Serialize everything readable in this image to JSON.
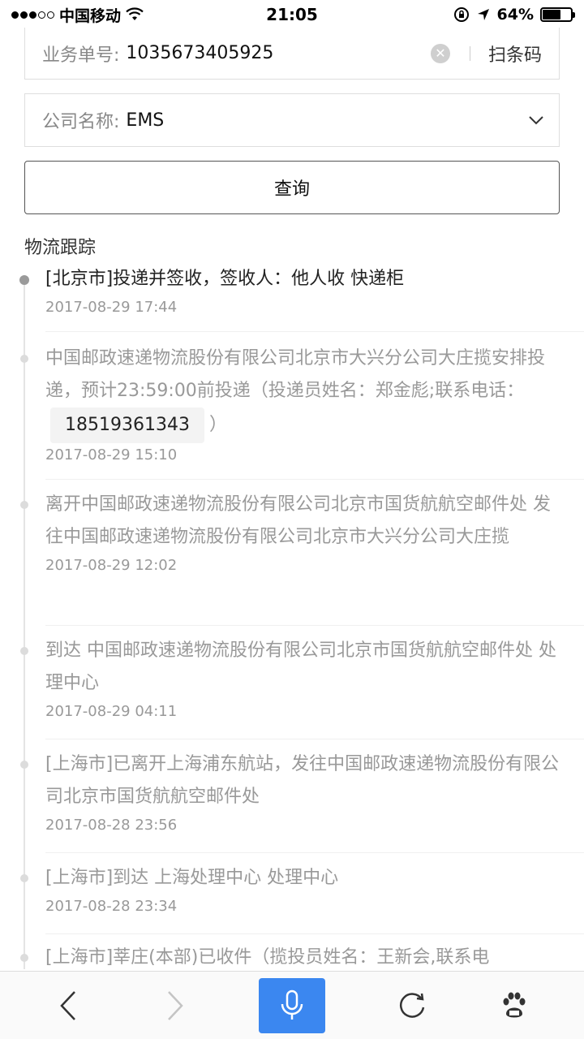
{
  "status_bar": {
    "carrier": "中国移动",
    "time": "21:05",
    "battery_percent": "64%",
    "battery_level": 0.64
  },
  "order_field": {
    "label": "业务单号:",
    "value": "1035673405925",
    "scan_label": "扫条码"
  },
  "company_field": {
    "label": "公司名称:",
    "value": "EMS"
  },
  "query_button": "查询",
  "section_title": "物流跟踪",
  "tracking": [
    {
      "text": "[北京市]投递并签收，签收人：他人收 快递柜",
      "time": "2017-08-29 17:44"
    },
    {
      "text_before": "中国邮政速递物流股份有限公司北京市大兴分公司大庄揽安排投递，预计23:59:00前投递（投递员姓名：郑金彪;联系电话：",
      "phone": "18519361343",
      "text_after": "）",
      "time": "2017-08-29 15:10"
    },
    {
      "text": "离开中国邮政速递物流股份有限公司北京市国货航航空邮件处 发往中国邮政速递物流股份有限公司北京市大兴分公司大庄揽",
      "time": "2017-08-29 12:02"
    },
    {
      "text": "到达 中国邮政速递物流股份有限公司北京市国货航航空邮件处 处理中心",
      "time": "2017-08-29 04:11"
    },
    {
      "text": "[上海市]已离开上海浦东航站，发往中国邮政速递物流股份有限公司北京市国货航航空邮件处",
      "time": "2017-08-28 23:56"
    },
    {
      "text": "[上海市]到达 上海处理中心 处理中心",
      "time": "2017-08-28 23:34"
    },
    {
      "text": "[上海市]莘庄(本部)已收件（揽投员姓名：王新会,联系电"
    }
  ]
}
